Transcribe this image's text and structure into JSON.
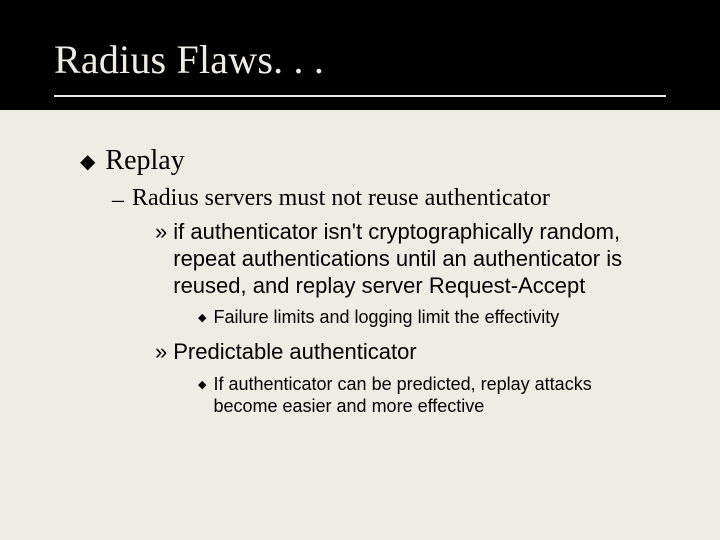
{
  "title": "Radius Flaws. . .",
  "l1": "Replay",
  "l2": "Radius servers must not reuse authenticator",
  "l3a": "if authenticator isn't cryptographically random, repeat authentications until an authenticator is reused, and replay server Request-Accept",
  "l4a": "Failure limits and logging limit the effectivity",
  "l3b": "Predictable authenticator",
  "l4b": "If authenticator can be predicted, replay attacks become easier and more effective"
}
